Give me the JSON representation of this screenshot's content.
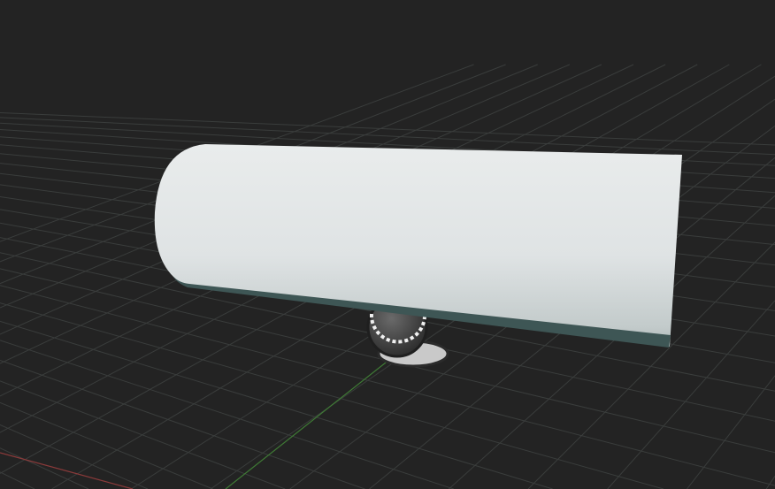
{
  "viewport": {
    "background_color": "#232323",
    "grid_color": "#3a3d3c",
    "x_axis_color": "#8a3a3a",
    "y_axis_color": "#3f7a35"
  },
  "scene": {
    "objects": [
      {
        "type": "cylinder",
        "color": "#e4e8e9",
        "edge_color": "#3e5655"
      },
      {
        "type": "light-probe-gizmo",
        "color": "#4a4a4a"
      }
    ]
  }
}
